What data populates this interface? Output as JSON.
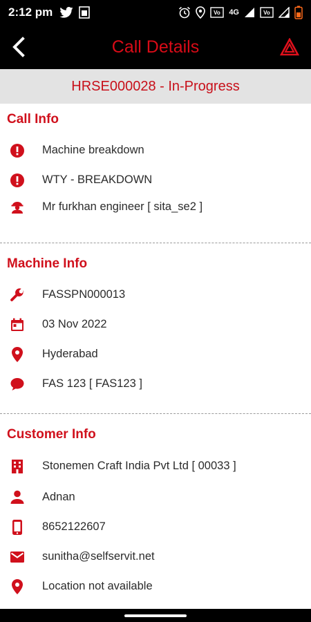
{
  "status_bar": {
    "time": "2:12 pm",
    "network": "4G",
    "icons": [
      "twitter-icon",
      "sim-icon",
      "alarm-icon",
      "location-icon",
      "volte-icon",
      "signal-icon",
      "wifi-icon",
      "battery-icon"
    ]
  },
  "header": {
    "title": "Call Details",
    "back_icon": "chevron-left-icon",
    "alert_icon": "warning-triangle-icon"
  },
  "ticket": {
    "label": "HRSE000028 - In-Progress"
  },
  "sections": {
    "call_info": {
      "title": "Call Info",
      "items": [
        {
          "icon": "exclamation-circle-icon",
          "text": "Machine breakdown"
        },
        {
          "icon": "exclamation-circle-icon",
          "text": "WTY - BREAKDOWN"
        },
        {
          "icon": "engineer-icon",
          "text": "Mr furkhan engineer [ sita_se2 ]"
        }
      ]
    },
    "machine_info": {
      "title": "Machine Info",
      "items": [
        {
          "icon": "wrench-icon",
          "text": "FASSPN000013"
        },
        {
          "icon": "calendar-icon",
          "text": "03 Nov 2022"
        },
        {
          "icon": "map-pin-icon",
          "text": "Hyderabad"
        },
        {
          "icon": "chat-bubble-icon",
          "text": "FAS 123 [ FAS123 ]"
        }
      ]
    },
    "customer_info": {
      "title": "Customer Info",
      "items": [
        {
          "icon": "building-icon",
          "text": "Stonemen Craft India Pvt Ltd [ 00033 ]"
        },
        {
          "icon": "person-icon",
          "text": "Adnan"
        },
        {
          "icon": "phone-icon",
          "text": "8652122607"
        },
        {
          "icon": "email-icon",
          "text": "sunitha@selfservit.net"
        },
        {
          "icon": "map-pin-icon",
          "text": "Location not available"
        }
      ]
    }
  },
  "colors": {
    "accent": "#d0101c",
    "header_bg": "#000000",
    "ticket_bg": "#e3e3e3"
  }
}
